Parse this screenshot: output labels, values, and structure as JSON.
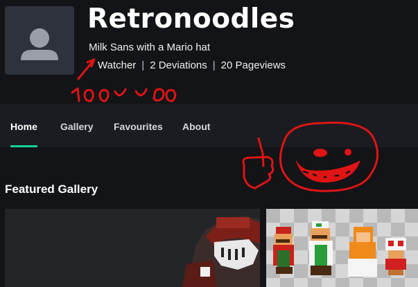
{
  "profile": {
    "username": "Retronoodles",
    "tagline": "Milk Sans with a Mario hat",
    "stats": {
      "watchers": "Watcher",
      "deviations": "2 Deviations",
      "pageviews": "20 Pageviews",
      "separator": "|"
    }
  },
  "nav": {
    "items": [
      {
        "label": "Home",
        "active": true
      },
      {
        "label": "Gallery",
        "active": false
      },
      {
        "label": "Favourites",
        "active": false
      },
      {
        "label": "About",
        "active": false
      }
    ]
  },
  "main": {
    "section_title": "Featured Gallery"
  },
  "colors": {
    "background": "#121417",
    "nav_background": "#1a1c21",
    "accent": "#16d39a",
    "doodle": "#e01414"
  },
  "icons": {
    "avatar": "default-user-icon"
  }
}
